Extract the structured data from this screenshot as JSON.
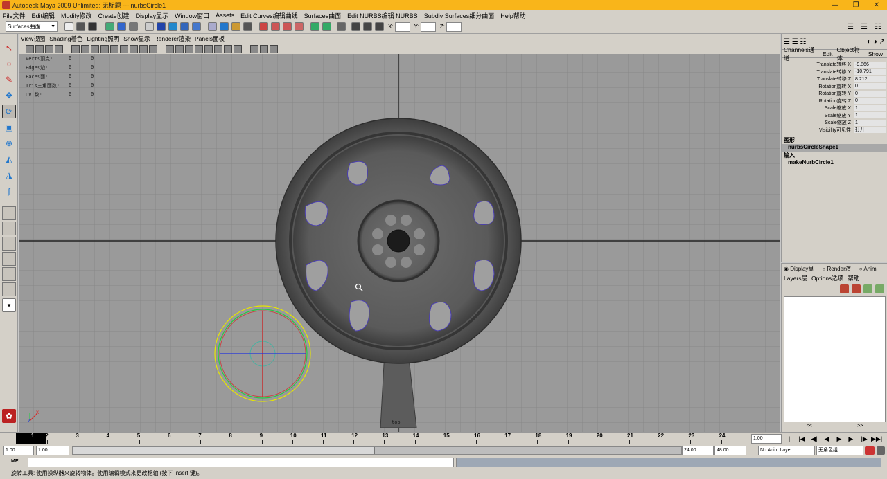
{
  "window": {
    "title": "Autodesk Maya 2009 Unlimited: 无标题   ---   nurbsCircle1",
    "controls": [
      "—",
      "❐",
      "✕"
    ]
  },
  "menubar": [
    "File文件",
    "Edit编辑",
    "Modify修改",
    "Create创建",
    "Display显示",
    "Window窗口",
    "Assets",
    "Edit Curves编辑曲线",
    "Surfaces曲面",
    "Edit NURBS编辑 NURBS",
    "Subdiv Surfaces细分曲面",
    "Help帮助"
  ],
  "toolbar": {
    "menu_set": "Surfaces曲面",
    "x_label": "X:",
    "y_label": "Y:",
    "z_label": "Z:"
  },
  "panel": {
    "menus": [
      "View视图",
      "Shading着色",
      "Lighting照明",
      "Show显示",
      "Renderer渲染",
      "Panels面板"
    ]
  },
  "hud": [
    {
      "label": "Verts顶点:",
      "v1": "0",
      "v2": "0"
    },
    {
      "label": "Edges边:",
      "v1": "0",
      "v2": "0"
    },
    {
      "label": "Faces面:",
      "v1": "0",
      "v2": "0"
    },
    {
      "label": "Tris三角面数:",
      "v1": "0",
      "v2": "0"
    },
    {
      "label": "UV 数:",
      "v1": "0",
      "v2": "0"
    }
  ],
  "camera_label": "top",
  "axis": {
    "x": "x",
    "z": "z"
  },
  "channel_box": {
    "menus": [
      "Channels通道",
      "Edit",
      "Object物体",
      "Show"
    ],
    "attributes": [
      {
        "name": "Translate转移 X",
        "value": "-9.866"
      },
      {
        "name": "Translate转移 Y",
        "value": "-10.791"
      },
      {
        "name": "Translate转移 Z",
        "value": "8.212"
      },
      {
        "name": "Rotation旋转 X",
        "value": "0"
      },
      {
        "name": "Rotation旋转 Y",
        "value": "0"
      },
      {
        "name": "Rotation旋转 Z",
        "value": "0"
      },
      {
        "name": "Scale缩放 X",
        "value": "1"
      },
      {
        "name": "Scale缩放 Y",
        "value": "1"
      },
      {
        "name": "Scale缩放 Z",
        "value": "1"
      },
      {
        "name": "Visibility可见性",
        "value": "打开"
      }
    ],
    "shape_header": "图形",
    "shape_node": "nurbsCircleShape1",
    "input_header": "输入",
    "input_node": "makeNurbCircle1"
  },
  "layer_editor": {
    "radios": [
      "Display显",
      "Render渲",
      "Anim"
    ],
    "menus": [
      "Layers层",
      "Options选项",
      "帮助"
    ],
    "scroll": [
      "<<",
      ">>"
    ]
  },
  "timeline": {
    "current_frame": "1",
    "ticks": [
      "1",
      "2",
      "3",
      "4",
      "5",
      "6",
      "7",
      "8",
      "9",
      "10",
      "11",
      "12",
      "13",
      "14",
      "15",
      "16",
      "17",
      "18",
      "19",
      "20",
      "21",
      "22",
      "23",
      "24"
    ],
    "current_field": "1.00",
    "playback": [
      "|◀◀",
      "|◀",
      "◀|",
      "◀",
      "▶",
      "▶|",
      "|▶",
      "▶▶|"
    ]
  },
  "range": {
    "start": "1.00",
    "start2": "1.00",
    "end": "24.00",
    "end2": "48.00",
    "anim_layer": "No Anim Layer",
    "char_set": "无角色组"
  },
  "cmdline": {
    "label": "MEL"
  },
  "helpline": "旋转工具: 使用操纵器来旋转物体。使用编辑模式来更改枢轴 (按下 Insert 键)。",
  "colors": {
    "titlebar": "#f9b51a",
    "viewport_bg": "#9a9a9a",
    "wheel_body": "#5a5a5a",
    "wheel_rim": "#444444",
    "manip_yellow": "#e6e600",
    "manip_green": "#22cc44",
    "manip_red": "#dd2222",
    "manip_blue": "#2233dd",
    "selection_outline": "#4b3fb0"
  }
}
